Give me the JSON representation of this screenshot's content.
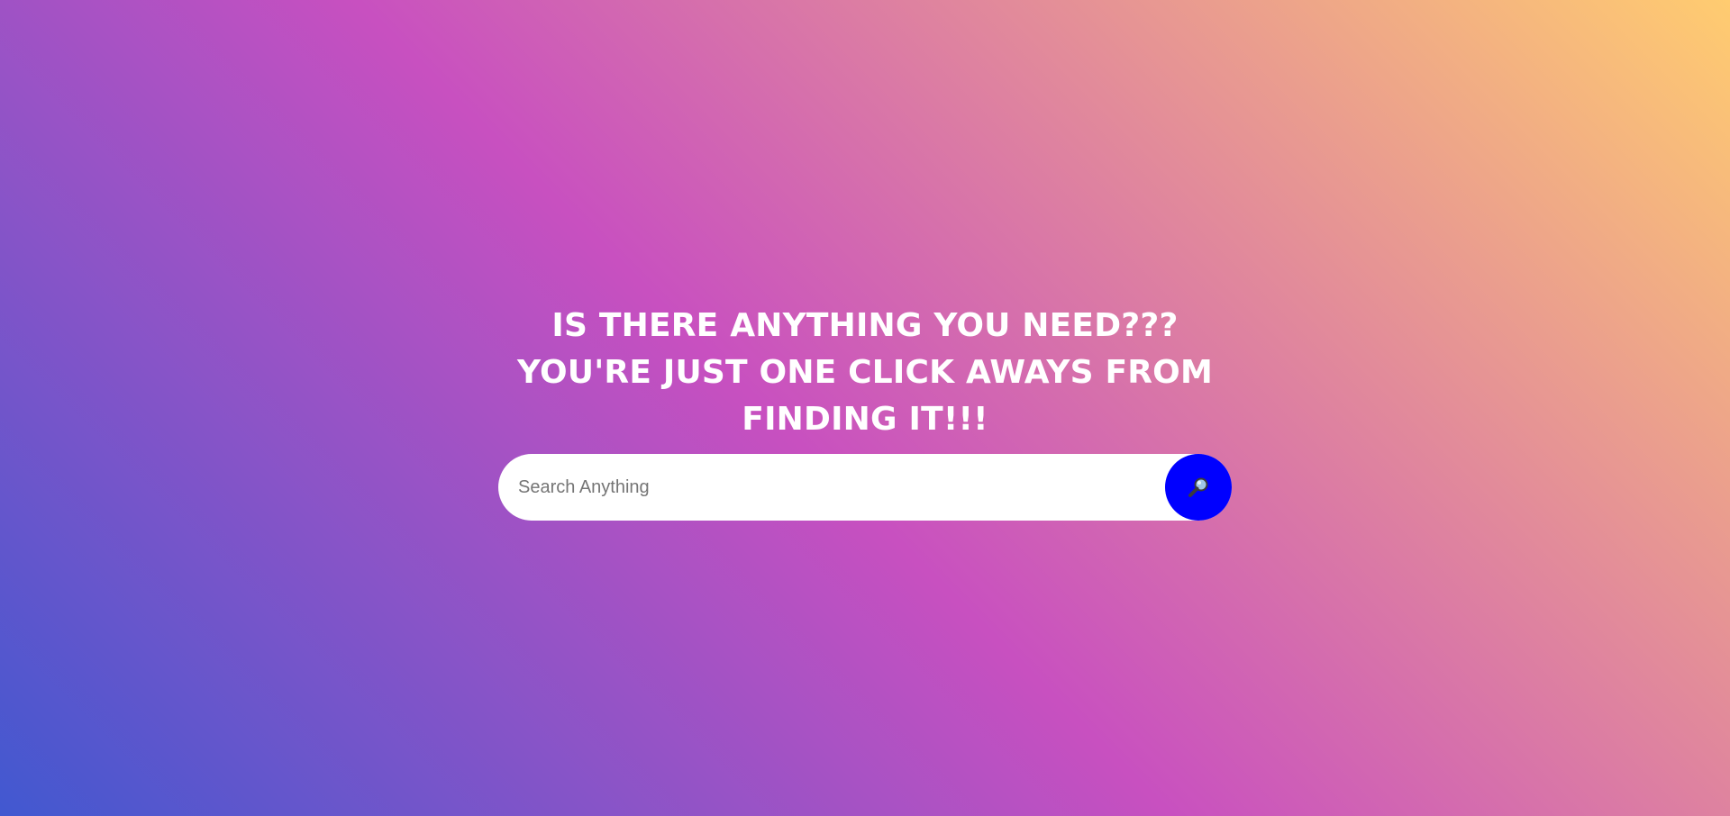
{
  "hero": {
    "headline": "IS THERE ANYTHING YOU NEED??? YOU'RE JUST ONE CLICK AWAYS FROM FINDING IT!!!"
  },
  "search": {
    "placeholder": "Search Anything",
    "value": "",
    "button_icon": "search-icon",
    "button_color": "#0000ff"
  },
  "colors": {
    "background_gradient": [
      "#4158d0",
      "#c850c0",
      "#ffcc70"
    ],
    "headline_text": "#ffffff",
    "input_background": "#ffffff"
  }
}
